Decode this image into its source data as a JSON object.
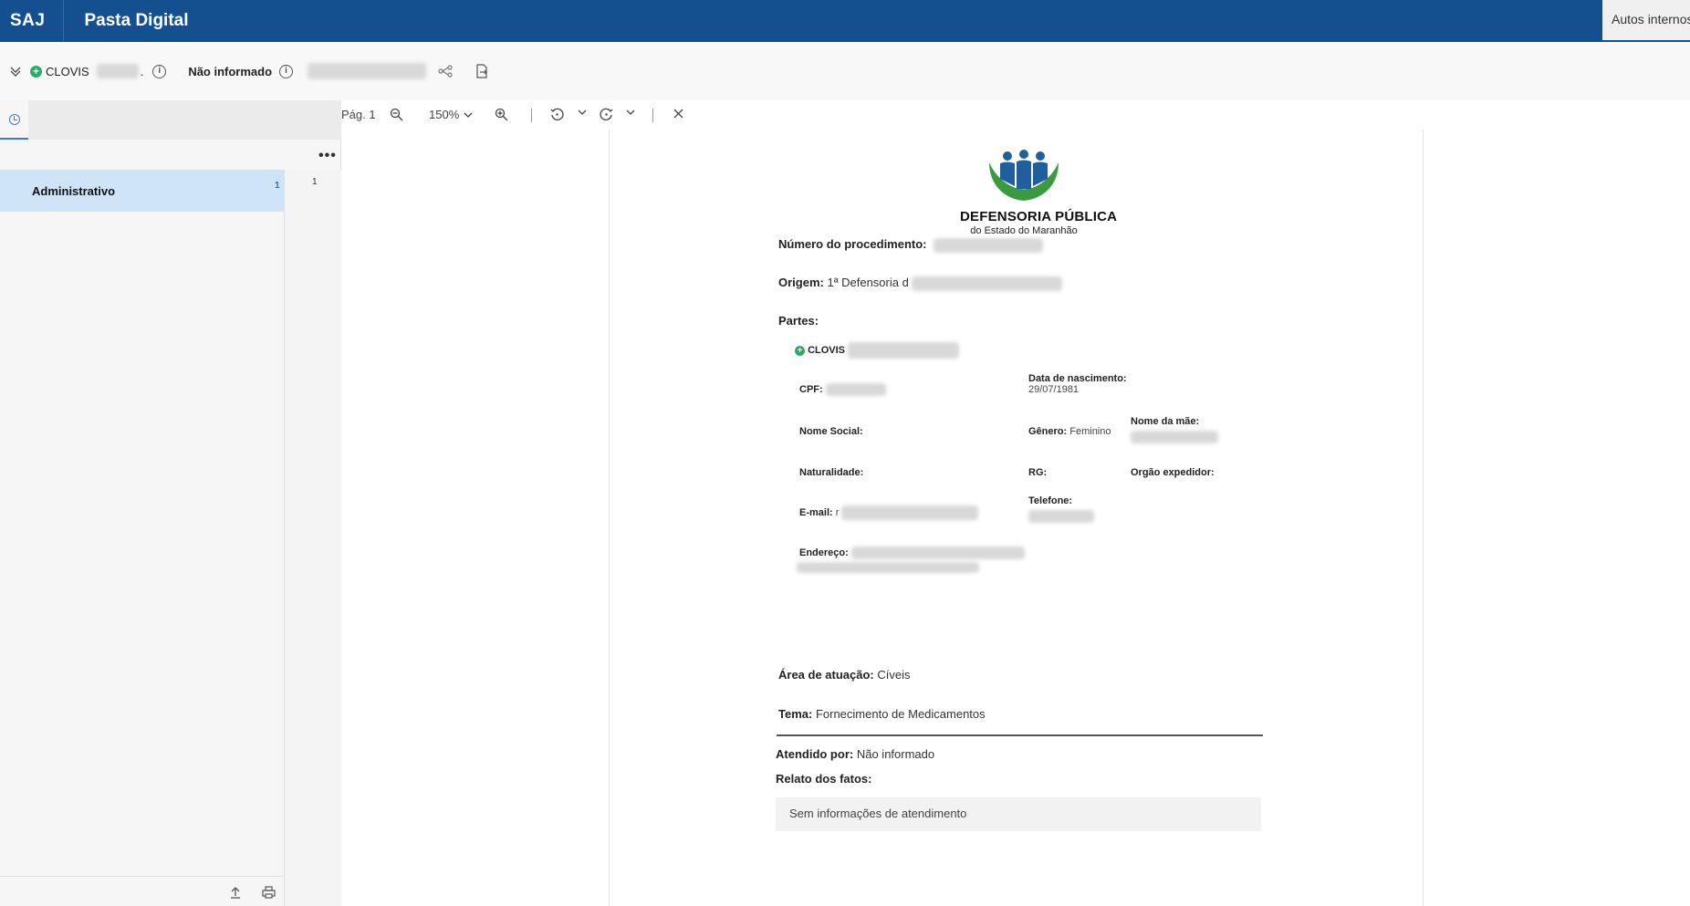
{
  "topbar": {
    "brand": "SAJ",
    "title": "Pasta Digital",
    "right_tab": "Autos internos"
  },
  "partybar": {
    "party_name": "CLOVIS",
    "dot": ".",
    "status_label": "Não informado",
    "icons": [
      "chevron-double-down-icon",
      "plus-circle-icon",
      "info-icon",
      "info-icon",
      "share-icon",
      "export-icon"
    ]
  },
  "sidebar": {
    "more": "•••",
    "folder": {
      "label": "Administrativo",
      "count": "1"
    },
    "page_number": "1"
  },
  "viewer": {
    "page_label": "Pág. 1",
    "zoom": "150%"
  },
  "document": {
    "logo": {
      "title": "DEFENSORIA PÚBLICA",
      "subtitle": "do Estado do Maranhão"
    },
    "numero_label": "Número do procedimento:",
    "origem_label": "Origem:",
    "origem_value": "1ª Defensoria d",
    "partes_label": "Partes:",
    "parte_nome": "CLOVIS",
    "cpf_label": "CPF:",
    "nascimento_label": "Data de nascimento:",
    "nascimento_value": "29/07/1981",
    "nome_social_label": "Nome Social:",
    "genero_label": "Gênero:",
    "genero_value": "Feminino",
    "nome_mae_label": "Nome da mãe:",
    "naturalidade_label": "Naturalidade:",
    "rg_label": "RG:",
    "orgao_label": "Orgão expedidor:",
    "email_label": "E-mail:",
    "email_value": "r",
    "telefone_label": "Telefone:",
    "endereco_label": "Endereço:",
    "area_label": "Área de atuação:",
    "area_value": "Cíveis",
    "tema_label": "Tema:",
    "tema_value": "Fornecimento de Medicamentos",
    "atendido_label": "Atendido por:",
    "atendido_value": "Não informado",
    "relato_label": "Relato dos fatos:",
    "relato_value": "Sem informações de atendimento"
  },
  "colors": {
    "topbar": "#14508f",
    "selected_folder": "#cfe4f7",
    "logo_green": "#3a9a3f",
    "logo_blue": "#1f5f9e"
  }
}
